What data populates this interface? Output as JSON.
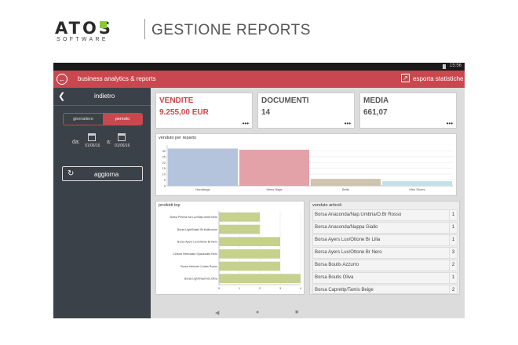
{
  "brand": {
    "logo_top": "ATOS",
    "logo_bottom": "SOFTWARE",
    "title": "GESTIONE REPORTS"
  },
  "status": {
    "time": "15:56"
  },
  "appbar": {
    "title": "business analytics & reports",
    "export_label": "esporta statistiche"
  },
  "sidebar": {
    "back_label": "indietro",
    "segments": [
      "giornaliero",
      "periodo"
    ],
    "active_segment": 1,
    "from_label": "da:",
    "from_date": "01/06/16",
    "to_label": "a:",
    "to_date": "01/06/16",
    "refresh_label": "aggiorna"
  },
  "kpis": [
    {
      "label": "VENDITE",
      "value": "9.255,00 EUR",
      "color": "#c9474f"
    },
    {
      "label": "DOCUMENTI",
      "value": "14",
      "color": "#555555"
    },
    {
      "label": "MEDIA",
      "value": "661,07",
      "color": "#555555"
    }
  ],
  "charts": {
    "reparto_title": "venduto per reparto",
    "prodotti_title": "prodotti top",
    "articoli_title": "venduto articoli"
  },
  "chart_data": [
    {
      "type": "bar",
      "title": "venduto per reparto",
      "categories": [
        "Handbags",
        "Mens Bags",
        "Belts",
        "Men Shoes"
      ],
      "values": [
        32,
        31,
        6,
        4
      ],
      "colors": [
        "#b4c4dc",
        "#e3a1a8",
        "#cfc4b0",
        "#c6dfe8"
      ],
      "ylim": [
        0,
        35
      ],
      "yticks": [
        0,
        5,
        10,
        15,
        20,
        25,
        30
      ]
    },
    {
      "type": "bar",
      "orientation": "horizontal",
      "title": "prodotti top",
      "categories": [
        "Borsa Prisma Kai Lux/Nap.Umbr.Nero",
        "Borsa Light/Nashi Br.Multicolore",
        "Borsa Ayers Lux/Ottone Br.Nero",
        "Cintura Intrecciato Spazzolato Nero",
        "Borsa Intreccio Cotato Rosso",
        "Borsa Light/Nashi Br.Oliva"
      ],
      "values": [
        2,
        2,
        3,
        3,
        3,
        4
      ],
      "color": "#c5d18d",
      "xlim": [
        0,
        4
      ],
      "xticks": [
        0,
        1,
        2,
        3,
        4
      ]
    }
  ],
  "articoli": [
    {
      "name": "Borsa Anaconda/Nap.Umbria/O.Br Rosso",
      "count": "1"
    },
    {
      "name": "Borsa Anaconda/Nappa Giallo",
      "count": "1"
    },
    {
      "name": "Borsa Ayers Lux/Ottone Br Lilla",
      "count": "1"
    },
    {
      "name": "Borsa Ayers Lux/Ottone Br Nero",
      "count": "3"
    },
    {
      "name": "Borsa Boutis Azzurro",
      "count": "2"
    },
    {
      "name": "Borsa Boutis Oliva",
      "count": "1"
    },
    {
      "name": "Borsa Caprettp/Tamis Beige",
      "count": "2"
    }
  ]
}
